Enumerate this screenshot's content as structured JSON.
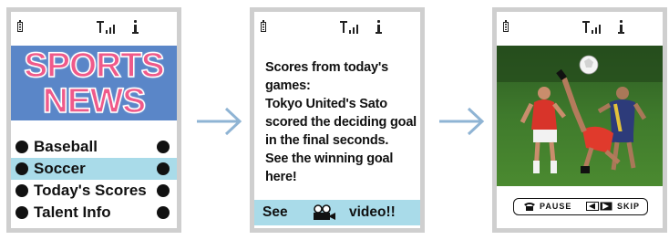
{
  "colors": {
    "accent_blue": "#a9dbe9",
    "banner_blue": "#5a86c8",
    "banner_pink": "#ef5a8a",
    "arrow": "#8fb4d4",
    "frame": "#cfcfcf"
  },
  "screen1": {
    "banner": {
      "line1": "SPORTS",
      "line2": "NEWS"
    },
    "menu": [
      {
        "label": "Baseball",
        "selected": false
      },
      {
        "label": "Soccer",
        "selected": true
      },
      {
        "label": "Today's Scores",
        "selected": false
      },
      {
        "label": "Talent Info",
        "selected": false
      }
    ]
  },
  "screen2": {
    "article_lines": [
      "Scores from today's",
      "games:",
      "Tokyo United's Sato",
      "scored the deciding goal",
      "in the final seconds.",
      "See the winning goal",
      "here!"
    ],
    "video_link": {
      "see": "See",
      "video": "video!!",
      "icon": "video-camera-icon"
    }
  },
  "screen3": {
    "photo": "soccer-players-photo",
    "controls": {
      "pause_label": "PAUSE",
      "skip_label": "SKIP",
      "phone_icon": "phone-icon",
      "skip_icon": "skip-arrows-icon"
    }
  },
  "status_icons": [
    "battery-icon",
    "signal-icon",
    "i-mode-icon"
  ]
}
